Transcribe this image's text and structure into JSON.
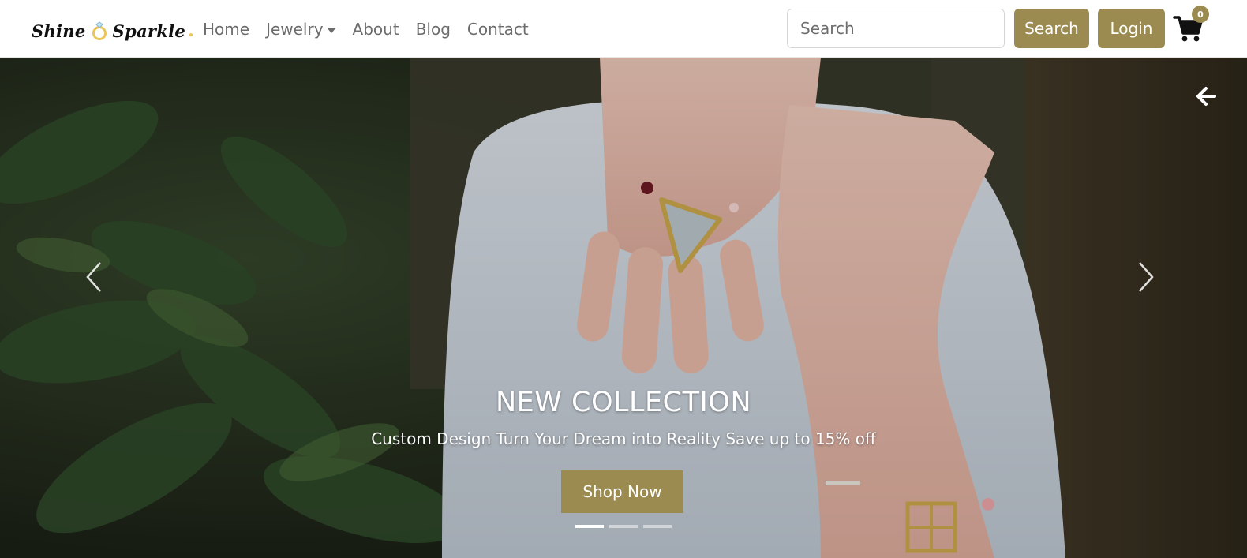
{
  "brand": {
    "name_left": "Shine",
    "name_right": "Sparkle",
    "dot": "."
  },
  "nav": {
    "items": [
      {
        "label": "Home"
      },
      {
        "label": "Jewelry"
      },
      {
        "label": "About"
      },
      {
        "label": "Blog"
      },
      {
        "label": "Contact"
      }
    ]
  },
  "search": {
    "placeholder": "Search",
    "button_label": "Search"
  },
  "login": {
    "label": "Login"
  },
  "cart": {
    "count": "0",
    "icon": "shopping-cart-icon"
  },
  "hero": {
    "title": "NEW COLLECTION",
    "subtitle": "Custom Design Turn Your Dream into Reality Save up to 15% off",
    "cta_label": "Shop Now",
    "slide_count": 3,
    "active_slide": 1
  },
  "colors": {
    "accent": "#9b8b51",
    "brand_dot": "#e8c65a",
    "nav_text": "#6c6c6c"
  }
}
